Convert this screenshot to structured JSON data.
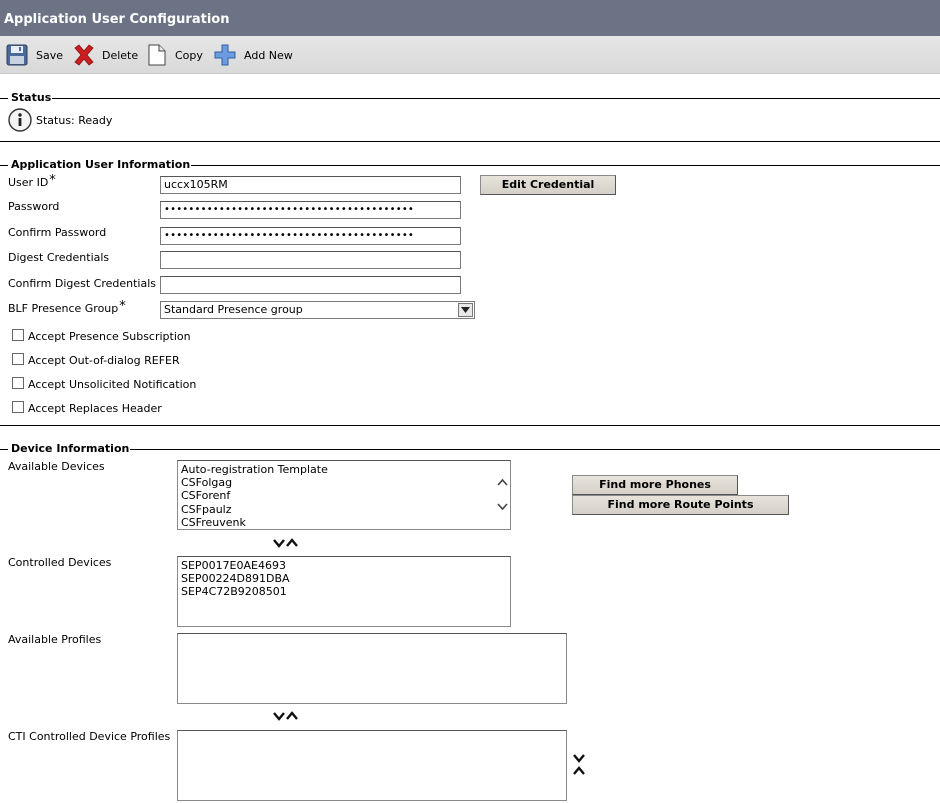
{
  "window": {
    "title": "Application User Configuration"
  },
  "toolbar": {
    "save_label": "Save",
    "delete_label": "Delete",
    "copy_label": "Copy",
    "add_new_label": "Add New"
  },
  "status": {
    "section_title": "Status",
    "text": "Status: Ready"
  },
  "app_user_info": {
    "section_title": "Application User Information",
    "user_id_label": "User ID",
    "user_id_value": "uccx105RM",
    "edit_credential_label": "Edit Credential",
    "password_label": "Password",
    "password_value": "•••••••••••••••••••••••••••••••••••••••••",
    "confirm_password_label": "Confirm Password",
    "confirm_password_value": "•••••••••••••••••••••••••••••••••••••••••",
    "digest_label": "Digest Credentials",
    "digest_value": "",
    "confirm_digest_label": "Confirm Digest Credentials",
    "confirm_digest_value": "",
    "blf_label": "BLF Presence Group",
    "blf_value": "Standard Presence group",
    "required_marker": "*",
    "checkboxes": [
      {
        "label": "Accept Presence Subscription",
        "checked": false
      },
      {
        "label": "Accept Out-of-dialog REFER",
        "checked": false
      },
      {
        "label": "Accept Unsolicited Notification",
        "checked": false
      },
      {
        "label": "Accept Replaces Header",
        "checked": false
      }
    ]
  },
  "device_info": {
    "section_title": "Device Information",
    "available_devices_label": "Available Devices",
    "available_devices": [
      "Auto-registration Template",
      "CSFolgag",
      "CSForenf",
      "CSFpaulz",
      "CSFreuvenk"
    ],
    "find_phones_label": "Find more Phones",
    "find_route_points_label": "Find more Route Points",
    "controlled_devices_label": "Controlled Devices",
    "controlled_devices": [
      "SEP0017E0AE4693",
      "SEP00224D891DBA",
      "SEP4C72B9208501"
    ],
    "available_profiles_label": "Available Profiles",
    "available_profiles": [],
    "cti_profiles_label": "CTI Controlled Device Profiles",
    "cti_profiles": []
  },
  "colors": {
    "titlebar": "#6b7384",
    "delete_red": "#cc1f1f",
    "add_blue": "#4a7fd0"
  }
}
